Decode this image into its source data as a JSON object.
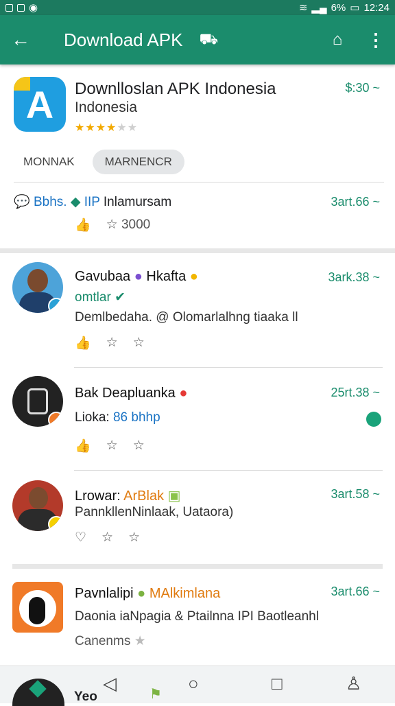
{
  "status_bar": {
    "left_icons": "",
    "battery": "6%",
    "time": "12:24"
  },
  "app_bar": {
    "title": "Download APK",
    "back_icon": "←",
    "title_icon": "⛟",
    "bookmark_icon": "⌂",
    "more_icon": "⋮"
  },
  "header": {
    "app_name": "Downlloslan APK Indonesia",
    "app_subtitle": "Indonesia",
    "price": "$:30 ~",
    "rating_filled": 4,
    "rating_total": 6,
    "chips": [
      "MONNAK",
      "MARNENCR"
    ],
    "info": {
      "prefix": "Bbhs.",
      "tag": "IIP",
      "text": "Inlamursam",
      "price": "3art.66 ~",
      "count": "3000"
    }
  },
  "posts": [
    {
      "title_a": "Gavubaa",
      "title_b": "Hkafta",
      "line2": "omtlar",
      "body": "Demlbedaha. @ Olomarlalhng tiaaka ll",
      "price": "3ark.38 ~"
    },
    {
      "title_a": "Bak Deapluanka",
      "line2_a": "Lioka:",
      "line2_b": "86 bhhp",
      "price": "25rt.38 ~"
    },
    {
      "title_a": "Lrowar:",
      "title_b": "ArBlak",
      "body": "PannkllenNinlaak, Uataora)",
      "price": "3art.58 ~"
    },
    {
      "title_a": "Pavnlalipi",
      "title_b": "MAlkimlana",
      "body": "Daonia iaNpagia & Ptailnna IPI Baotleanhl",
      "line3": "Canenms",
      "price": "3art.66 ~"
    }
  ],
  "bottom": {
    "label": "Yeo"
  },
  "colors": {
    "primary": "#1b8c6c",
    "accent_green": "#1a8c6c"
  }
}
